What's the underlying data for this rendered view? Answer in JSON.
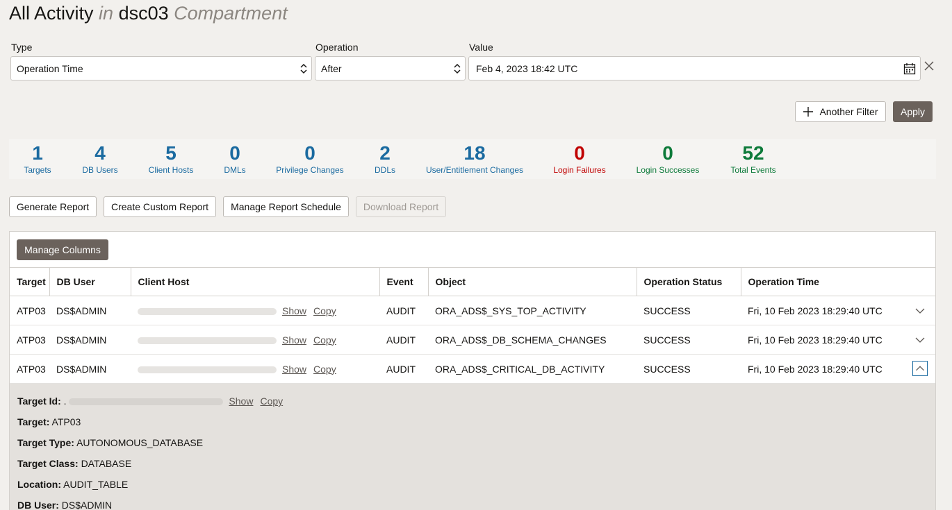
{
  "title": {
    "main": "All Activity",
    "in": "in",
    "compartment": "dsc03",
    "suffix": "Compartment"
  },
  "filter": {
    "type_label": "Type",
    "type_value": "Operation Time",
    "operation_label": "Operation",
    "operation_value": "After",
    "value_label": "Value",
    "value_value": "Feb 4, 2023 18:42 UTC",
    "another_filter": "Another Filter",
    "apply": "Apply"
  },
  "stats": [
    {
      "value": "1",
      "label": "Targets",
      "color": "#1a6aa0"
    },
    {
      "value": "4",
      "label": "DB Users",
      "color": "#1a6aa0"
    },
    {
      "value": "5",
      "label": "Client Hosts",
      "color": "#1a6aa0"
    },
    {
      "value": "0",
      "label": "DMLs",
      "color": "#1a6aa0"
    },
    {
      "value": "0",
      "label": "Privilege Changes",
      "color": "#1a6aa0"
    },
    {
      "value": "2",
      "label": "DDLs",
      "color": "#1a6aa0"
    },
    {
      "value": "18",
      "label": "User/Entitlement Changes",
      "color": "#1a6aa0"
    },
    {
      "value": "0",
      "label": "Login Failures",
      "color": "#c00000"
    },
    {
      "value": "0",
      "label": "Login Successes",
      "color": "#0d7a3a"
    },
    {
      "value": "52",
      "label": "Total Events",
      "color": "#0d7a3a"
    }
  ],
  "actions": {
    "generate": "Generate Report",
    "custom": "Create Custom Report",
    "schedule": "Manage Report Schedule",
    "download": "Download Report"
  },
  "table": {
    "manage_columns": "Manage Columns",
    "headers": [
      "Target",
      "DB User",
      "Client Host",
      "Event",
      "Object",
      "Operation Status",
      "Operation Time"
    ],
    "show": "Show",
    "copy": "Copy",
    "rows": [
      {
        "target": "ATP03",
        "db_user": "DS$ADMIN",
        "event": "AUDIT",
        "object": "ORA_ADS$_SYS_TOP_ACTIVITY",
        "status": "SUCCESS",
        "time": "Fri, 10 Feb 2023 18:29:40 UTC"
      },
      {
        "target": "ATP03",
        "db_user": "DS$ADMIN",
        "event": "AUDIT",
        "object": "ORA_ADS$_DB_SCHEMA_CHANGES",
        "status": "SUCCESS",
        "time": "Fri, 10 Feb 2023 18:29:40 UTC"
      },
      {
        "target": "ATP03",
        "db_user": "DS$ADMIN",
        "event": "AUDIT",
        "object": "ORA_ADS$_CRITICAL_DB_ACTIVITY",
        "status": "SUCCESS",
        "time": "Fri, 10 Feb 2023 18:29:40 UTC"
      }
    ]
  },
  "detail": {
    "target_id_label": "Target Id:",
    "target_id_value": ".",
    "target_label": "Target:",
    "target_value": "ATP03",
    "target_type_label": "Target Type:",
    "target_type_value": "AUTONOMOUS_DATABASE",
    "target_class_label": "Target Class:",
    "target_class_value": "DATABASE",
    "location_label": "Location:",
    "location_value": "AUDIT_TABLE",
    "db_user_label": "DB User:",
    "db_user_value": "DS$ADMIN"
  }
}
